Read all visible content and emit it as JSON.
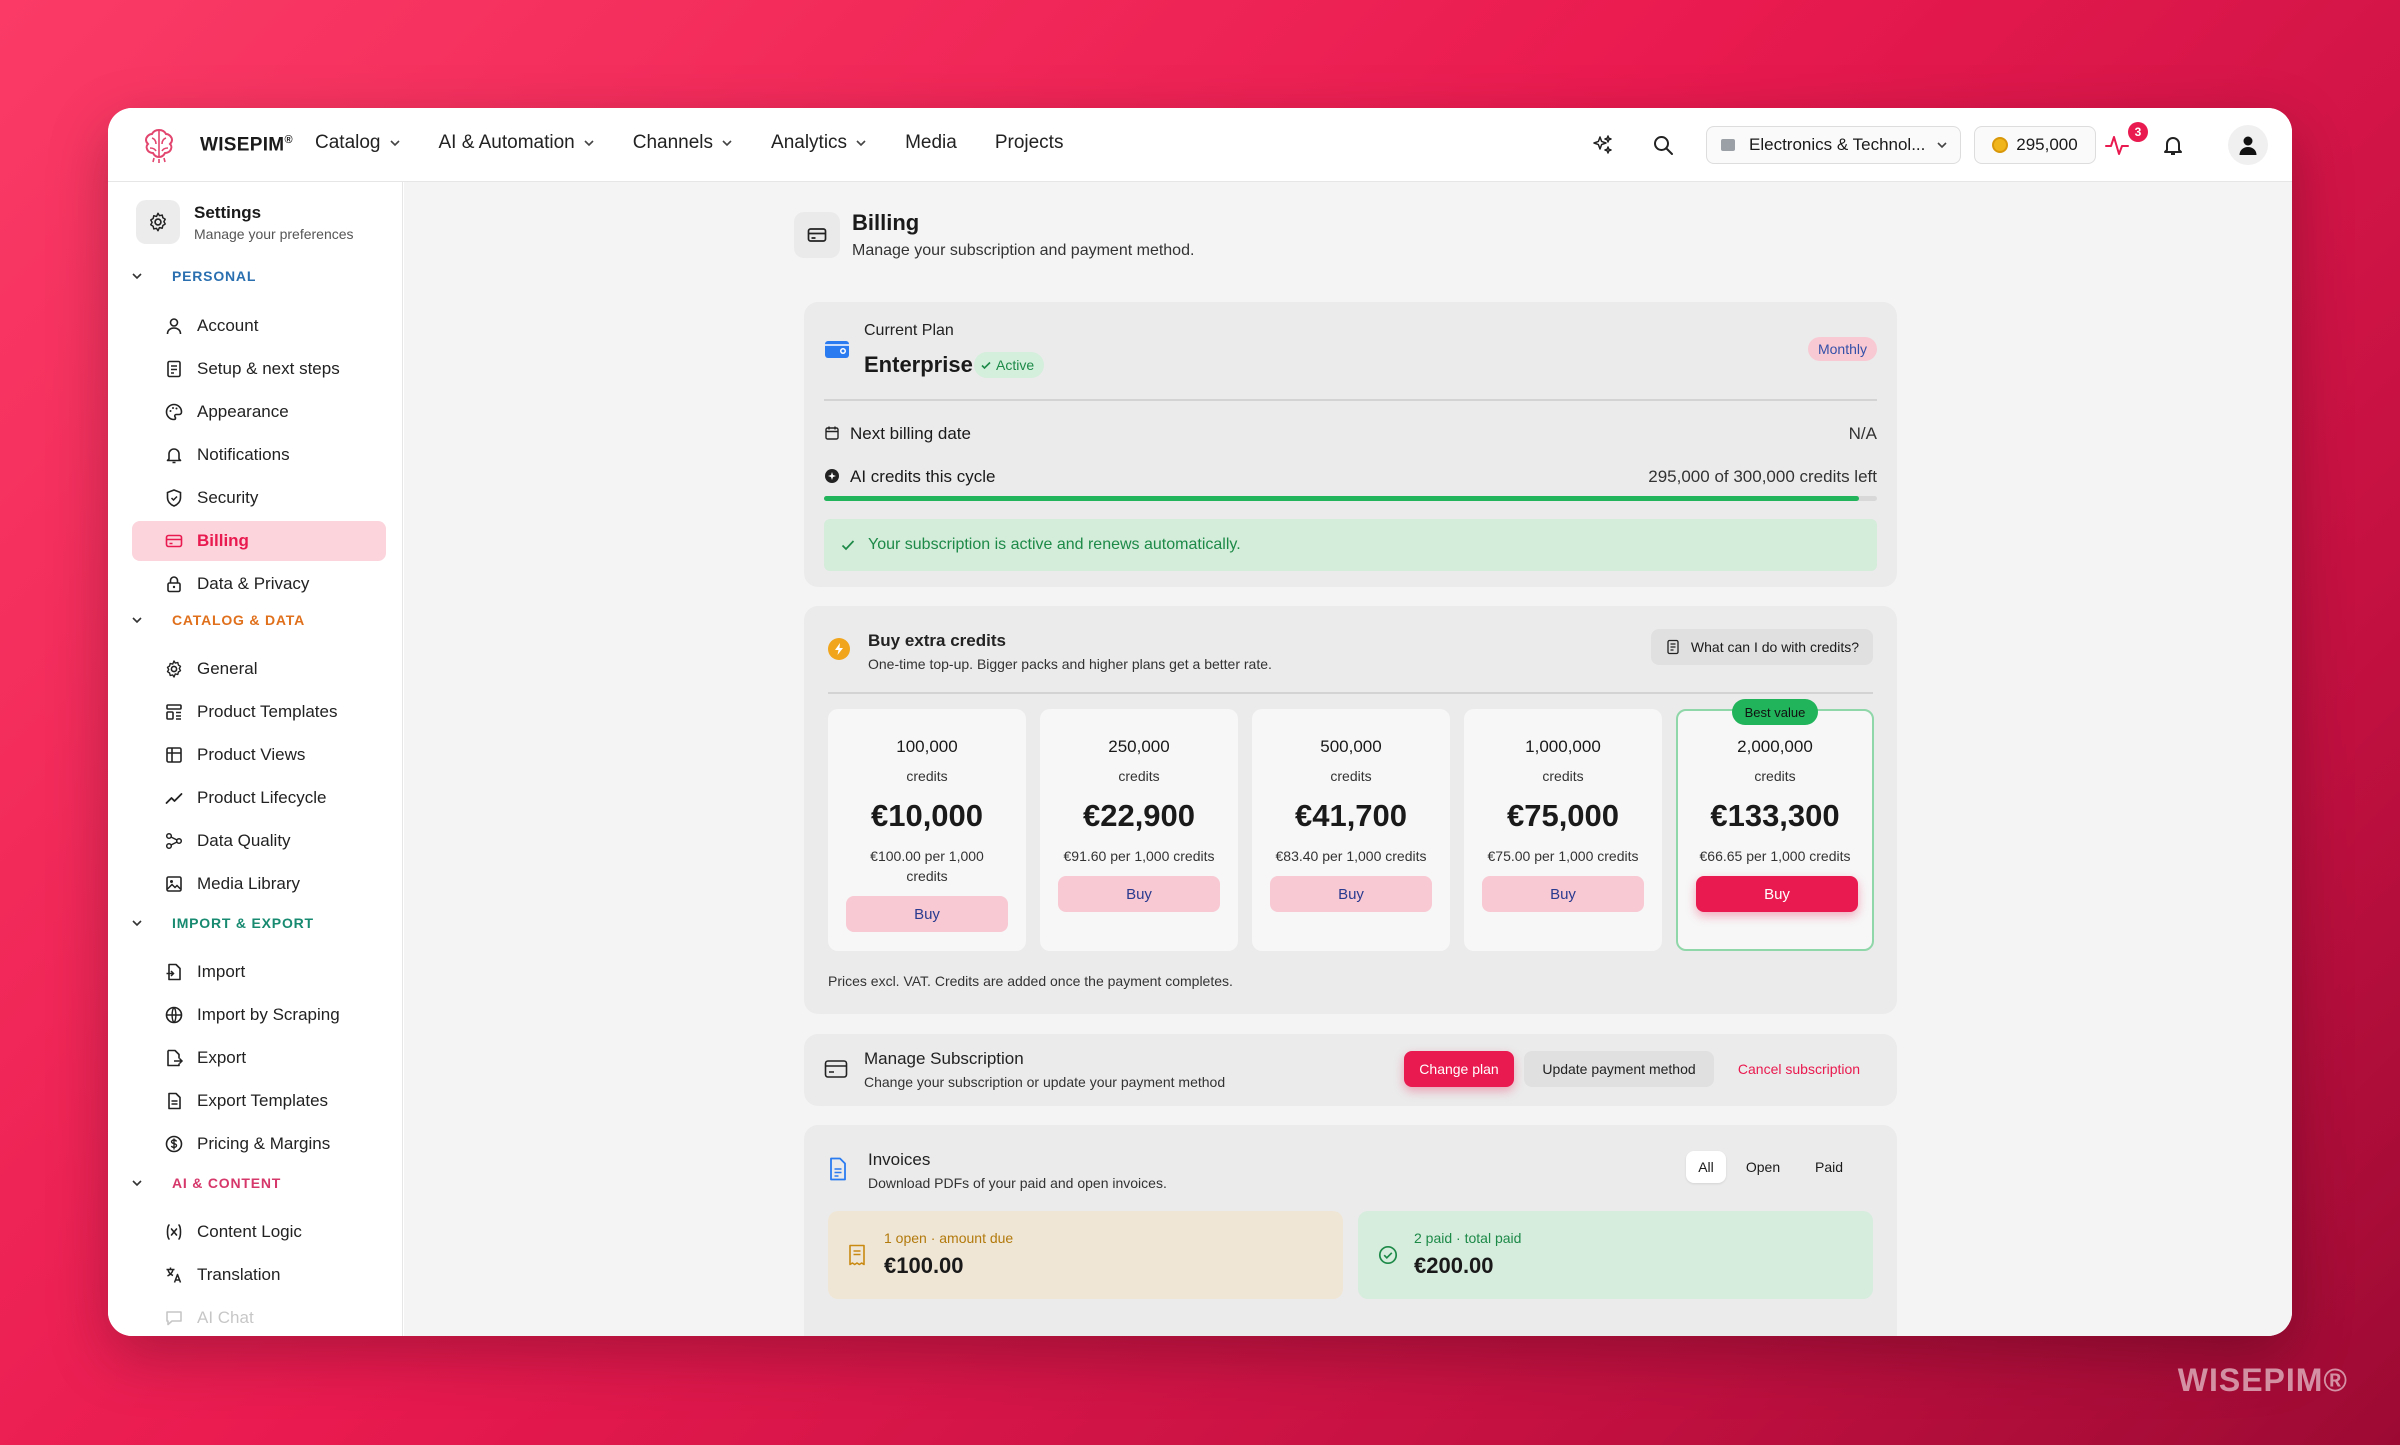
{
  "app": {
    "brand": "WISEPIM",
    "brand_mark": "®",
    "watermark": "WISEPIM®"
  },
  "nav": {
    "items": [
      {
        "label": "Catalog",
        "dropdown": true
      },
      {
        "label": "AI & Automation",
        "dropdown": true
      },
      {
        "label": "Channels",
        "dropdown": true
      },
      {
        "label": "Analytics",
        "dropdown": true
      },
      {
        "label": "Media",
        "dropdown": false
      },
      {
        "label": "Projects",
        "dropdown": false
      }
    ]
  },
  "topbar": {
    "workspace": "Electronics & Technol...",
    "credits": "295,000",
    "activity_badge": "3"
  },
  "sidebar": {
    "title": "Settings",
    "subtitle": "Manage your preferences",
    "sections": [
      {
        "label": "PERSONAL",
        "color": "#2a6fb0",
        "items": [
          "Account",
          "Setup & next steps",
          "Appearance",
          "Notifications",
          "Security",
          "Billing",
          "Data & Privacy"
        ]
      },
      {
        "label": "CATALOG & DATA",
        "color": "#e0701c",
        "items": [
          "General",
          "Product Templates",
          "Product Views",
          "Product Lifecycle",
          "Data Quality",
          "Media Library"
        ]
      },
      {
        "label": "IMPORT & EXPORT",
        "color": "#178a70",
        "items": [
          "Import",
          "Import by Scraping",
          "Export",
          "Export Templates",
          "Pricing & Margins"
        ]
      },
      {
        "label": "AI & CONTENT",
        "color": "#d6386b",
        "items": [
          "Content Logic",
          "Translation",
          "AI Chat"
        ]
      }
    ],
    "active_item": "Billing"
  },
  "billing": {
    "title": "Billing",
    "subtitle": "Manage your subscription and payment method.",
    "plan": {
      "label": "Current Plan",
      "name": "Enterprise",
      "status": "Active",
      "period": "Monthly",
      "next_billing_label": "Next billing date",
      "next_billing_value": "N/A",
      "credits_label": "AI credits this cycle",
      "credits_value": "295,000 of 300,000 credits left",
      "credits_fraction": 0.983,
      "notice": "Your subscription is active and renews automatically."
    },
    "extra": {
      "title": "Buy extra credits",
      "subtitle": "One-time top-up. Bigger packs and higher plans get a better rate.",
      "help_button": "What can I do with credits?",
      "packs": [
        {
          "credits": "100,000",
          "unit": "credits",
          "price": "€10,000",
          "per": "€100.00 per 1,000 credits",
          "buy": "Buy",
          "best": false
        },
        {
          "credits": "250,000",
          "unit": "credits",
          "price": "€22,900",
          "per": "€91.60 per 1,000 credits",
          "buy": "Buy",
          "best": false
        },
        {
          "credits": "500,000",
          "unit": "credits",
          "price": "€41,700",
          "per": "€83.40 per 1,000 credits",
          "buy": "Buy",
          "best": false
        },
        {
          "credits": "1,000,000",
          "unit": "credits",
          "price": "€75,000",
          "per": "€75.00 per 1,000 credits",
          "buy": "Buy",
          "best": false
        },
        {
          "credits": "2,000,000",
          "unit": "credits",
          "price": "€133,300",
          "per": "€66.65 per 1,000 credits",
          "buy": "Buy",
          "best": true,
          "tag": "Best value"
        }
      ],
      "footnote": "Prices excl. VAT. Credits are added once the payment completes."
    },
    "manage": {
      "title": "Manage Subscription",
      "subtitle": "Change your subscription or update your payment method",
      "change_plan": "Change plan",
      "update_payment": "Update payment method",
      "cancel": "Cancel subscription"
    },
    "invoices": {
      "title": "Invoices",
      "subtitle": "Download PDFs of your paid and open invoices.",
      "tabs": [
        "All",
        "Open",
        "Paid"
      ],
      "active_tab": "All",
      "open_label": "1 open · amount due",
      "open_amount": "€100.00",
      "paid_label": "2 paid · total paid",
      "paid_amount": "€200.00"
    }
  }
}
